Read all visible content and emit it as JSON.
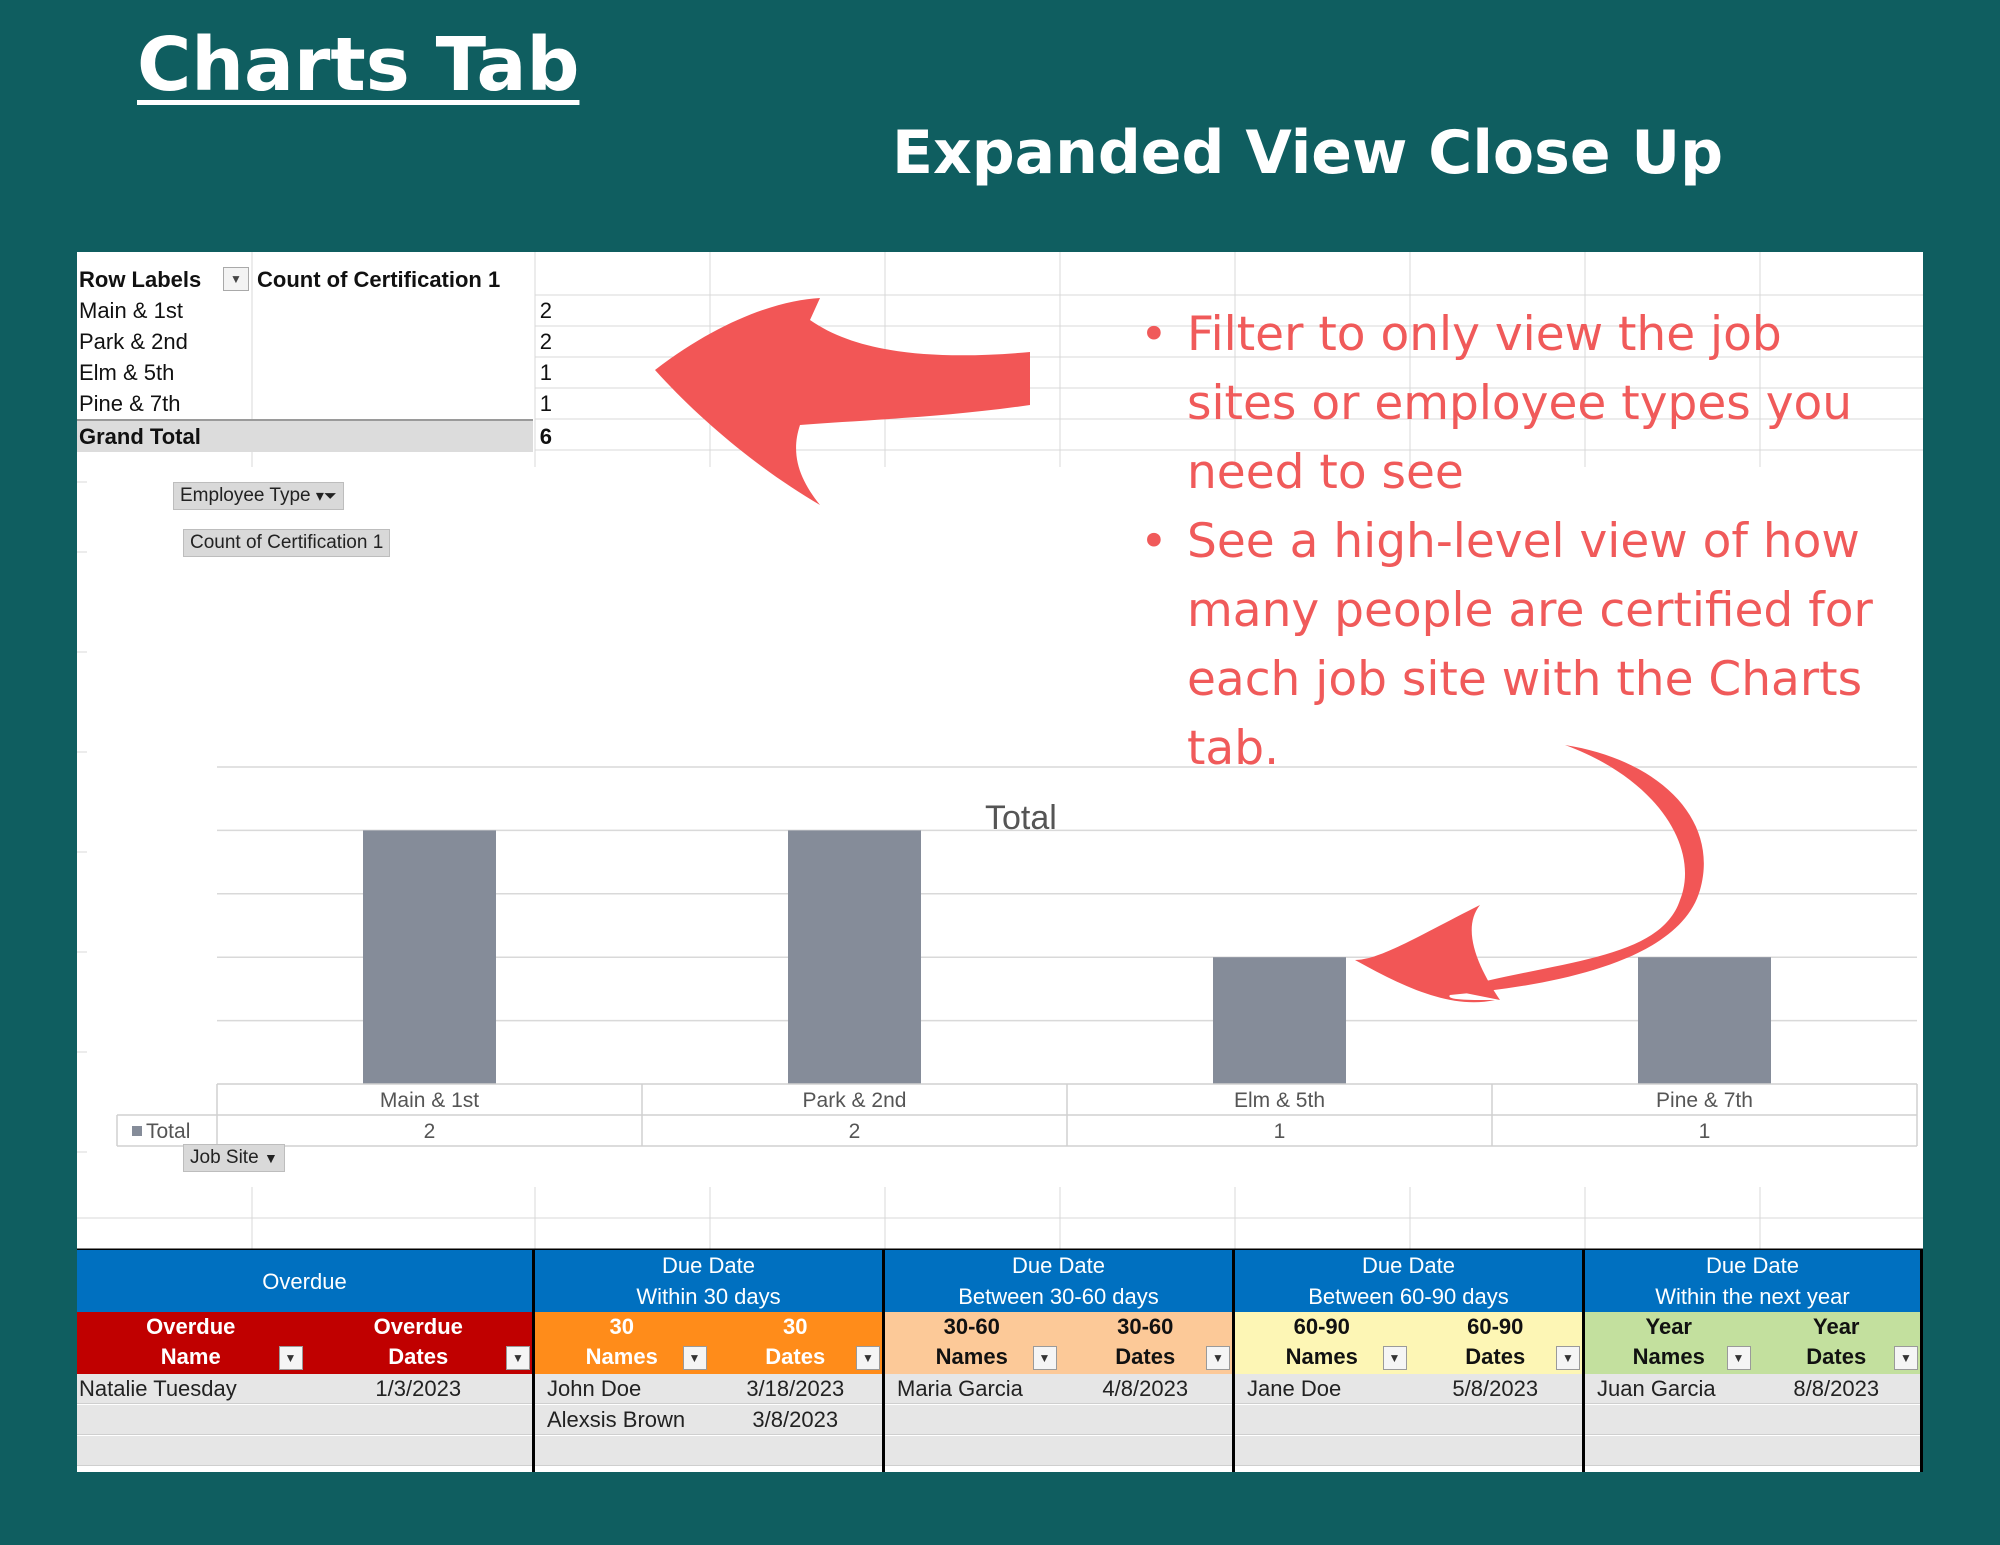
{
  "header": {
    "title": "Charts Tab",
    "subtitle": "Expanded View Close Up"
  },
  "pivot": {
    "row_labels_header": "Row Labels",
    "value_header": "Count of Certification 1",
    "rows": [
      {
        "label": "Main & 1st",
        "value": "2"
      },
      {
        "label": "Park & 2nd",
        "value": "2"
      },
      {
        "label": "Elm & 5th",
        "value": "1"
      },
      {
        "label": "Pine & 7th",
        "value": "1"
      }
    ],
    "grand_total_label": "Grand Total",
    "grand_total_value": "6"
  },
  "chart_fields": {
    "filter_button": "Employee Type",
    "value_button": "Count of Certification 1",
    "axis_button": "Job Site",
    "legend_total": "Total"
  },
  "chart_data": {
    "type": "bar",
    "title": "Total",
    "categories": [
      "Main & 1st",
      "Park & 2nd",
      "Elm & 5th",
      "Pine & 7th"
    ],
    "series": [
      {
        "name": "Total",
        "values": [
          2,
          2,
          1,
          1
        ]
      }
    ],
    "ylim": [
      0,
      2.5
    ],
    "grid": true,
    "data_table": true,
    "colors": {
      "bar": "#858c99"
    }
  },
  "callout": {
    "bullets": [
      "Filter to only view the job sites or employee types you need to see",
      "See a high-level view of how many people are certified for each job site with the Charts tab."
    ],
    "color": "#f05a5a"
  },
  "due_table": {
    "groups": [
      {
        "header": "Overdue",
        "col1": "Overdue\nName",
        "col2": "Overdue\nDates",
        "color": "#c00000",
        "text_color": "#ffffff",
        "rows": [
          {
            "name": "Natalie Tuesday",
            "date": "1/3/2023"
          }
        ]
      },
      {
        "header": "Due Date\nWithin 30 days",
        "col1": "30\nNames",
        "col2": "30\nDates",
        "color": "#ff8c1a",
        "text_color": "#ffffff",
        "rows": [
          {
            "name": "John Doe",
            "date": "3/18/2023"
          },
          {
            "name": "Alexsis Brown",
            "date": "3/8/2023"
          }
        ]
      },
      {
        "header": "Due Date\nBetween 30-60 days",
        "col1": "30-60\nNames",
        "col2": "30-60\nDates",
        "color": "#fcc998",
        "text_color": "#111111",
        "rows": [
          {
            "name": "Maria Garcia",
            "date": "4/8/2023"
          }
        ]
      },
      {
        "header": "Due Date\nBetween 60-90 days",
        "col1": "60-90\nNames",
        "col2": "60-90\nDates",
        "color": "#fdf6b5",
        "text_color": "#111111",
        "rows": [
          {
            "name": "Jane Doe",
            "date": "5/8/2023"
          }
        ]
      },
      {
        "header": "Due Date\nWithin the next year",
        "col1": "Year\nNames",
        "col2": "Year\nDates",
        "color": "#c3e09e",
        "text_color": "#111111",
        "rows": [
          {
            "name": "Juan Garcia",
            "date": "8/8/2023"
          }
        ]
      }
    ]
  }
}
